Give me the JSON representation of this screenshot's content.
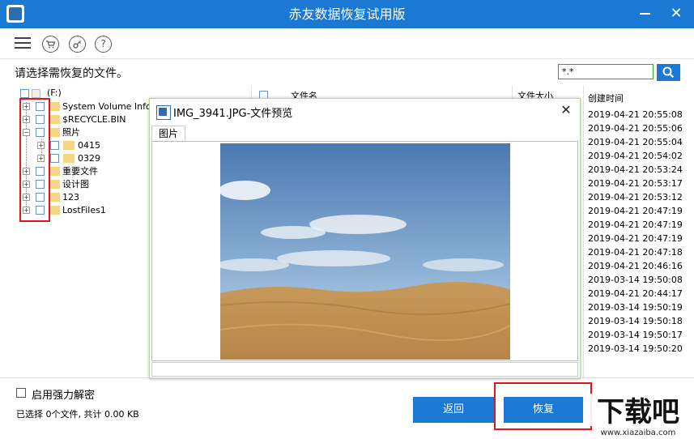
{
  "window": {
    "title": "赤友数据恢复试用版",
    "minimize_icon": "minimize-icon",
    "close_glyph": "✕"
  },
  "toolbar": {
    "icons": [
      "menu-icon",
      "cart-icon",
      "key-icon",
      "help-icon"
    ],
    "help_glyph": "?"
  },
  "prompt": "请选择需恢复的文件。",
  "filter": {
    "value": "*.*"
  },
  "tree": {
    "root": "(F:)",
    "items": [
      {
        "label": "System Volume Inform",
        "level": 1
      },
      {
        "label": "$RECYCLE.BIN",
        "level": 1
      },
      {
        "label": "照片",
        "level": 1,
        "expanded": true
      },
      {
        "label": "0415",
        "level": 2
      },
      {
        "label": "0329",
        "level": 2
      },
      {
        "label": "重要文件",
        "level": 1
      },
      {
        "label": "设计图",
        "level": 1
      },
      {
        "label": "123",
        "level": 1
      },
      {
        "label": "LostFiles1",
        "level": 1
      }
    ]
  },
  "list": {
    "headers": {
      "name": "文件名",
      "size": "文件大小",
      "created": "创建时间"
    },
    "created_times": [
      "2019-04-21 20:55:08",
      "2019-04-21 20:55:06",
      "2019-04-21 20:55:04",
      "2019-04-21 20:54:02",
      "2019-04-21 20:53:24",
      "2019-04-21 20:53:17",
      "2019-04-21 20:53:12",
      "2019-04-21 20:47:19",
      "2019-04-21 20:47:19",
      "2019-04-21 20:47:19",
      "2019-04-21 20:47:18",
      "2019-04-21 20:46:16",
      "2019-03-14 19:50:08",
      "2019-04-21 20:44:17",
      "2019-03-14 19:50:19",
      "2019-03-14 19:50:18",
      "2019-03-14 19:50:17",
      "2019-03-14 19:50:20"
    ]
  },
  "preview": {
    "title": "IMG_3941.JPG-文件预览",
    "tab": "图片",
    "close_glyph": "✕"
  },
  "options": {
    "force_decrypt": "启用强力解密"
  },
  "status": "已选择 0个文件, 共计 0.00 KB",
  "buttons": {
    "back": "返回",
    "recover": "恢复"
  },
  "watermark": {
    "text": "下载吧",
    "url": "www.xiazaiba.com"
  },
  "colors": {
    "accent": "#1b79d4",
    "highlight": "#e5141b",
    "filter_border": "#2fa82f"
  }
}
